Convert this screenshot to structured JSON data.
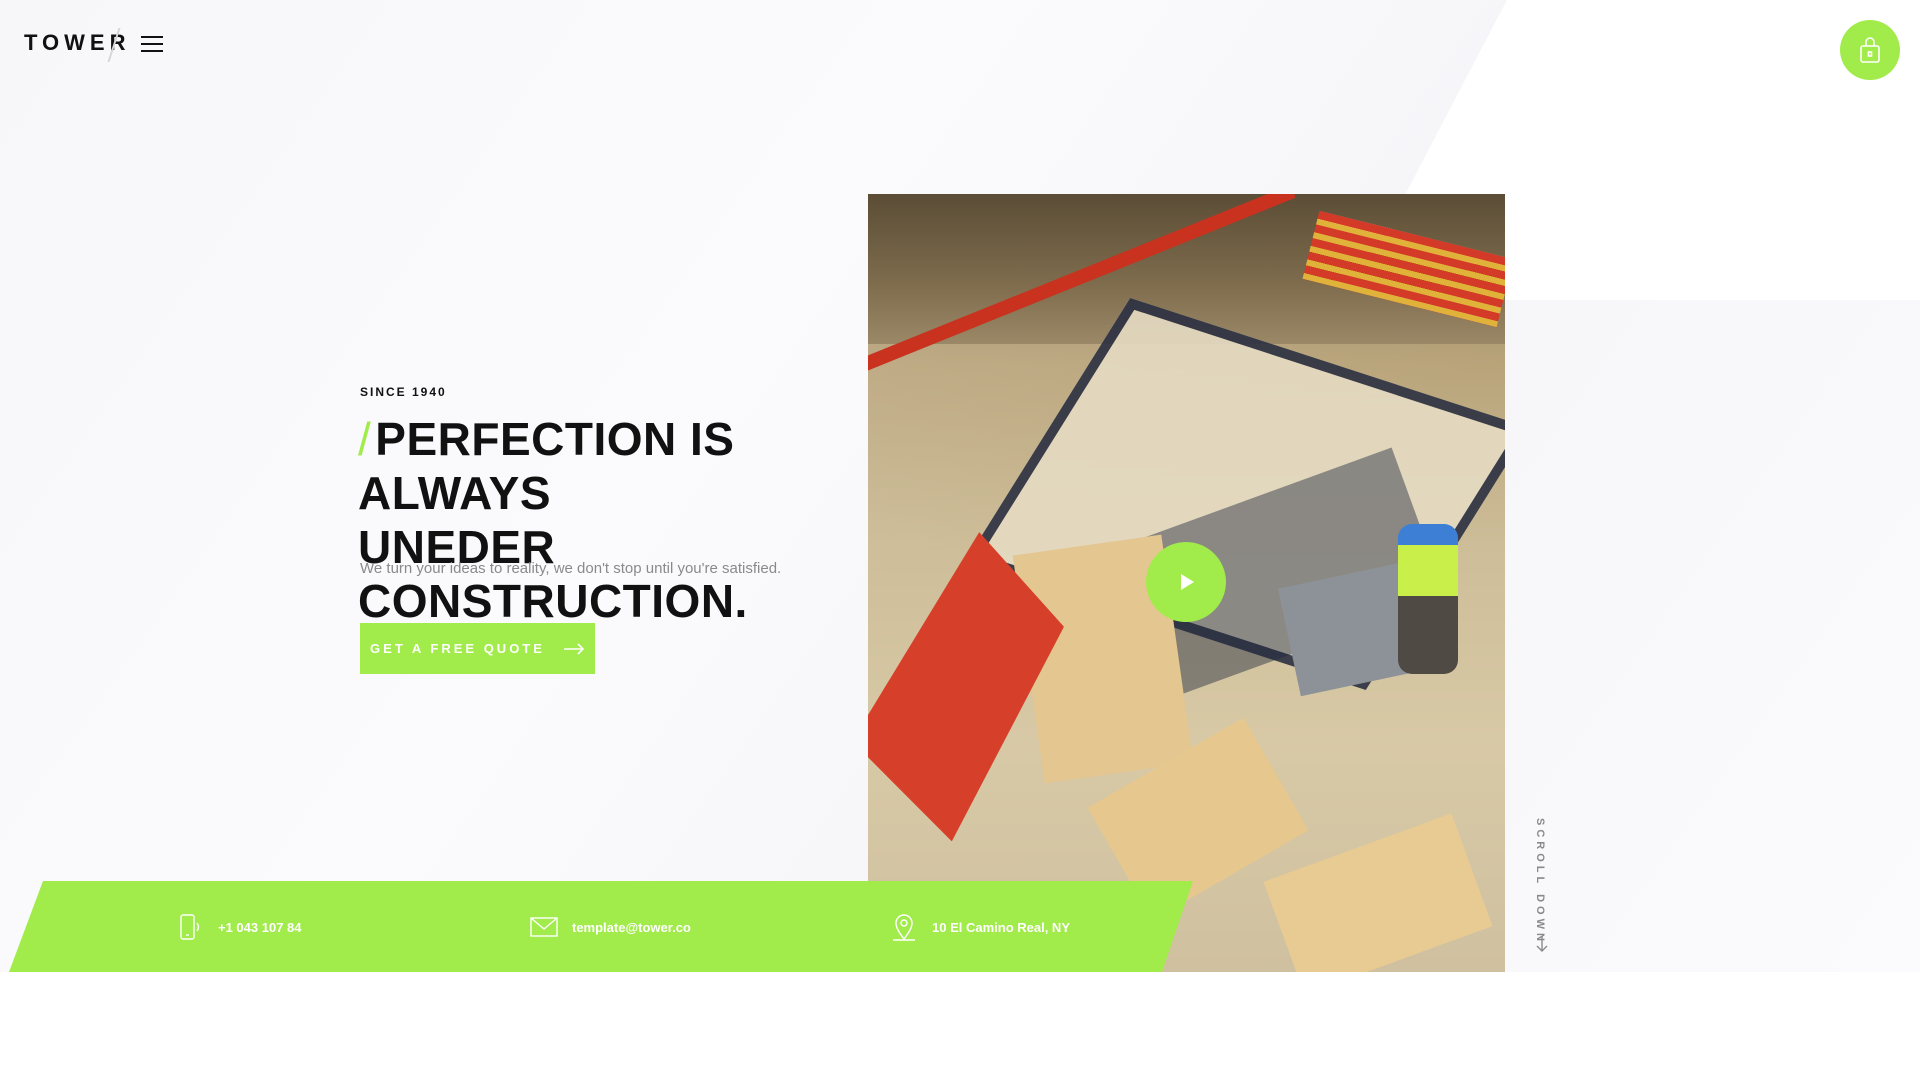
{
  "header": {
    "logo": "TOWER",
    "menu_icon": "hamburger-menu-icon",
    "cart_icon": "shopping-bag-icon"
  },
  "hero": {
    "tagline": "SINCE 1940",
    "headline_accent": "/",
    "headline_line1": "PERFECTION IS ALWAYS",
    "headline_line2": "UNEDER CONSTRUCTION.",
    "subtitle": "We turn your ideas to reality, we don't stop until you're satisfied.",
    "cta_label": "GET A FREE QUOTE",
    "play_icon": "play-icon"
  },
  "scroll": {
    "label": "SCROLL DOWN"
  },
  "contact": {
    "phone": "+1 043 107 84",
    "email": "template@tower.co",
    "address": "10 El Camino Real, NY"
  },
  "colors": {
    "accent": "#a1ec4b",
    "text": "#111111",
    "muted": "#8a8a8a"
  }
}
